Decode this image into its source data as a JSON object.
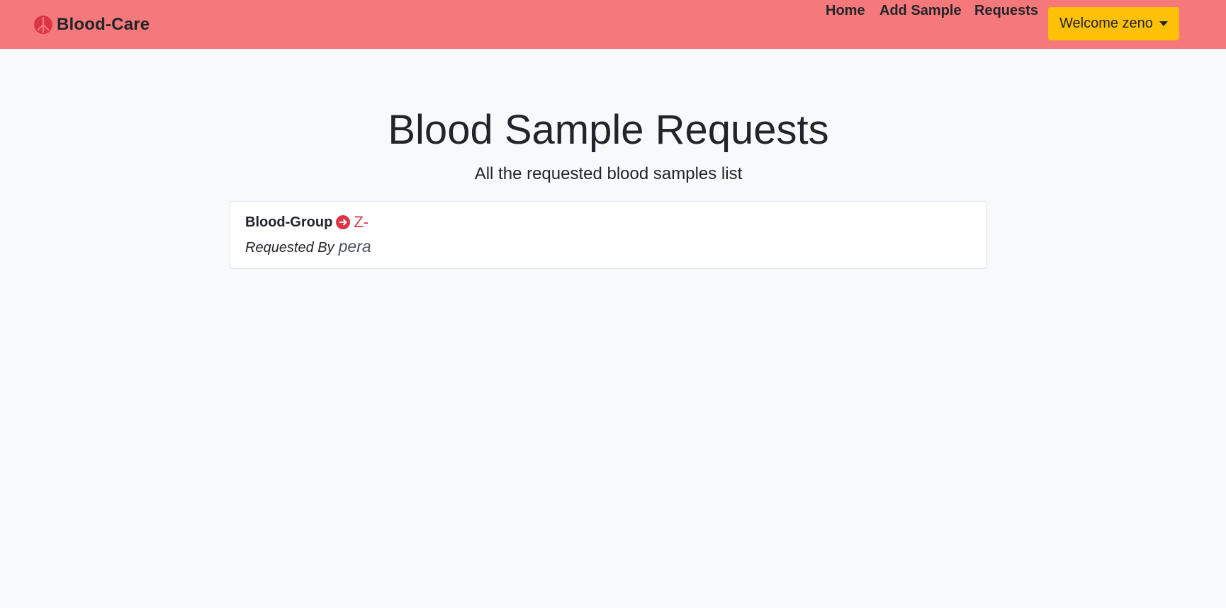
{
  "navbar": {
    "brand": "Blood-Care",
    "brand_icon": "peace-icon",
    "links": [
      "Home",
      "Add Sample",
      "Requests"
    ],
    "user_menu": "Welcome zeno",
    "colors": {
      "navbar_bg": "#f5787a",
      "user_menu_bg": "#ffc107"
    }
  },
  "main": {
    "title": "Blood Sample Requests",
    "subtitle": "All the requested blood samples list"
  },
  "requests": [
    {
      "blood_group_label": "Blood-Group",
      "blood_group_icon": "arrow-right-circle-icon",
      "blood_group_value": "Z-",
      "requested_by_label": "Requested By",
      "requested_by_value": "pera"
    }
  ]
}
